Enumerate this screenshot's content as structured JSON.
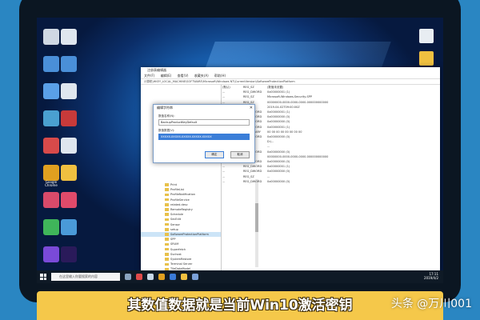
{
  "caption": "其数值数据就是当前Win10激活密钥",
  "watermark": "头条 @万川001",
  "taskbar": {
    "search_placeholder": "在这里输入你要搜索的内容",
    "time": "17:11",
    "date": "2019/4/2"
  },
  "desktop_icons_left": [
    {
      "name": "recycle-bin-icon",
      "label": "",
      "color": "#cfd8e3"
    },
    {
      "name": "computer-icon",
      "label": "",
      "color": "#4a8fd8"
    },
    {
      "name": "network-icon",
      "label": "",
      "color": "#5aa0e8"
    },
    {
      "name": "control-panel-icon",
      "label": "",
      "color": "#4aa0d0"
    },
    {
      "name": "app-icon",
      "label": "",
      "color": "#d84a4a"
    },
    {
      "name": "chrome-icon",
      "label": "Google Chrome",
      "color": "#e0a020"
    },
    {
      "name": "app-icon",
      "label": "",
      "color": "#d84a6a"
    },
    {
      "name": "app-icon",
      "label": "",
      "color": "#3fb55a"
    },
    {
      "name": "app-icon",
      "label": "",
      "color": "#7a4ad8"
    }
  ],
  "desktop_icons_left2": [
    {
      "name": "file-icon",
      "label": "",
      "color": "#dfe6ee"
    },
    {
      "name": "file-icon",
      "label": "",
      "color": "#4a8fd8"
    },
    {
      "name": "file-icon",
      "label": "",
      "color": "#dfe6ee"
    },
    {
      "name": "app-icon",
      "label": "",
      "color": "#c83a3a"
    },
    {
      "name": "file-icon",
      "label": "",
      "color": "#dfe6ee"
    },
    {
      "name": "folder-icon",
      "label": "",
      "color": "#f0c040"
    },
    {
      "name": "app-icon",
      "label": "",
      "color": "#e04a6a"
    },
    {
      "name": "app-icon",
      "label": "",
      "color": "#4a9ad8"
    },
    {
      "name": "adobe-icon",
      "label": "",
      "color": "#2a1a5a"
    }
  ],
  "regedit": {
    "title": "注册表编辑器",
    "menu": [
      "文件(F)",
      "编辑(E)",
      "查看(V)",
      "收藏夹(A)",
      "帮助(H)"
    ],
    "address": "计算机\\HKEY_LOCAL_MACHINE\\SOFTWARE\\Microsoft\\Windows NT\\CurrentVersion\\SoftwareProtectionPlatform",
    "tree": [
      "Print",
      "ProfileList",
      "ProfileNotification",
      "ProfileService",
      "related.desc",
      "RemoteRegistry",
      "Schedule",
      "SecEdit",
      "Sensor",
      "setup",
      "SoftwareProtectionPlatform",
      "SPP",
      "SRUM",
      "Superfetch",
      "Svchost",
      "SystemRestore",
      "Terminal Server",
      "TileDataModel",
      "Time Zones",
      "Tracing",
      "UAC",
      "UnattendSettings"
    ],
    "selected_tree_index": 10,
    "values": [
      [
        "(默认)",
        "REG_SZ",
        "(数值未设置)"
      ],
      [
        "...",
        "REG_DWORD",
        "0x00000001 (1)"
      ],
      [
        "...",
        "REG_SZ",
        "Microsoft-Windows-Security-SPP"
      ],
      [
        "...",
        "REG_SZ",
        "00000000-0000-0000-0000-000000000000"
      ],
      [
        "...",
        "REG_SZ",
        "2019-04-02T09:00:00Z"
      ],
      [
        "...",
        "REG_DWORD",
        "0x00000001 (1)"
      ],
      [
        "...",
        "REG_DWORD",
        "0x00000000 (0)"
      ],
      [
        "...",
        "REG_DWORD",
        "0x00000000 (0)"
      ],
      [
        "...",
        "REG_DWORD",
        "0x00000001 (1)"
      ],
      [
        "...",
        "REG_BINARY",
        "00 00 00 00 00 00 00 00"
      ],
      [
        "...",
        "REG_DWORD",
        "0x00000000 (0)"
      ],
      [
        "...",
        "REG_SZ",
        "D:\\..."
      ],
      [
        "...",
        "REG_SZ",
        "..."
      ],
      [
        "...",
        "REG_DWORD",
        "0x00000000 (0)"
      ],
      [
        "...",
        "REG_SZ",
        "00000000-0000-0000-0000-000000000000"
      ],
      [
        "...",
        "REG_DWORD",
        "0x00000000 (0)"
      ],
      [
        "...",
        "REG_DWORD",
        "0x00000001 (1)"
      ],
      [
        "...",
        "REG_DWORD",
        "0x00000000 (0)"
      ],
      [
        "...",
        "REG_SZ",
        "..."
      ],
      [
        "...",
        "REG_DWORD",
        "0x00000000 (0)"
      ]
    ]
  },
  "dialog": {
    "title": "编辑字符串",
    "name_label": "数值名称(N):",
    "name_value": "BackupProductKeyDefault",
    "data_label": "数值数据(V):",
    "data_value": "XXXXX-XXXXX-XXXXX-XXXXX-XXXXX",
    "ok_label": "确定",
    "cancel_label": "取消"
  }
}
